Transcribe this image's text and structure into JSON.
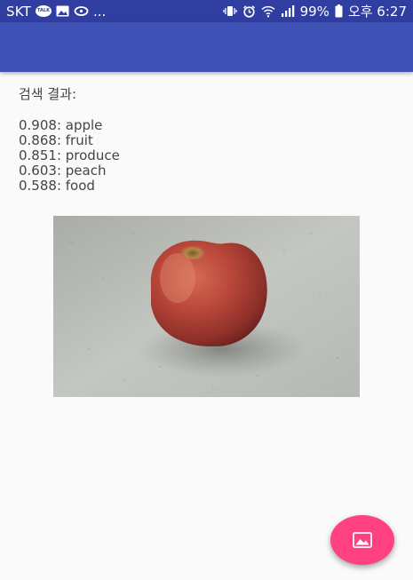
{
  "status_bar": {
    "carrier": "SKT",
    "more": "...",
    "battery": "99%",
    "time": "오후 6:27",
    "left_icons": [
      "kakaotalk-icon",
      "image-icon",
      "sync-icon"
    ],
    "right_icons": [
      "vibrate-icon",
      "alarm-icon",
      "wifi-icon",
      "signal-icon",
      "battery-icon"
    ]
  },
  "app_bar": {
    "color": "#3f51b5"
  },
  "results": {
    "title": "검색 결과:",
    "items": [
      {
        "text": "0.908: apple"
      },
      {
        "text": "0.868: fruit"
      },
      {
        "text": "0.851: produce"
      },
      {
        "text": "0.603: peach"
      },
      {
        "text": "0.588: food"
      }
    ]
  },
  "photo": {
    "subject": "apple-photo"
  },
  "fab": {
    "icon": "image-icon",
    "color": "#ff4081"
  }
}
